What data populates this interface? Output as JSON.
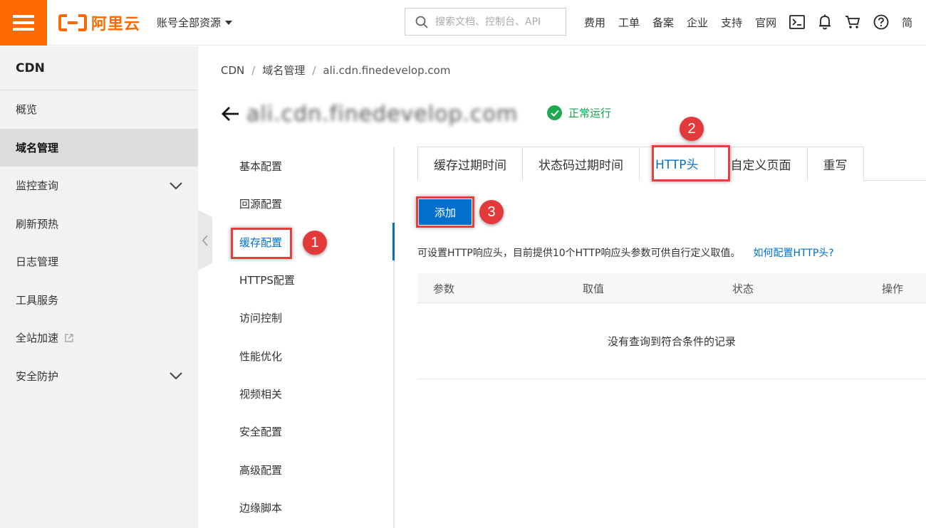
{
  "topbar": {
    "logo_text": "阿里云",
    "account_selector": "账号全部资源",
    "search_placeholder": "搜索文档、控制台、API",
    "nav_links": [
      "费用",
      "工单",
      "备案",
      "企业",
      "支持",
      "官网"
    ],
    "lang_label": "简",
    "icons": [
      "terminal-icon",
      "bell-icon",
      "cart-icon",
      "help-icon"
    ],
    "accent_color": "#ff6a00"
  },
  "sidebar": {
    "title": "CDN",
    "items": [
      {
        "label": "概览"
      },
      {
        "label": "域名管理",
        "active": true
      },
      {
        "label": "监控查询",
        "expandable": true
      },
      {
        "label": "刷新预热"
      },
      {
        "label": "日志管理"
      },
      {
        "label": "工具服务"
      },
      {
        "label": "全站加速",
        "external": true
      },
      {
        "label": "安全防护",
        "expandable": true
      }
    ]
  },
  "breadcrumb": [
    "CDN",
    "域名管理",
    "ali.cdn.finedevelop.com"
  ],
  "header": {
    "domain": "ali.cdn.finedevelop.com",
    "status": "正常运行",
    "status_color": "#1fa84f"
  },
  "subnav": {
    "items": [
      {
        "label": "基本配置"
      },
      {
        "label": "回源配置"
      },
      {
        "label": "缓存配置",
        "active": true
      },
      {
        "label": "HTTPS配置"
      },
      {
        "label": "访问控制"
      },
      {
        "label": "性能优化"
      },
      {
        "label": "视频相关"
      },
      {
        "label": "安全配置"
      },
      {
        "label": "高级配置"
      },
      {
        "label": "边缘脚本"
      }
    ]
  },
  "tabs": [
    {
      "label": "缓存过期时间"
    },
    {
      "label": "状态码过期时间"
    },
    {
      "label": "HTTP头",
      "active": true
    },
    {
      "label": "自定义页面"
    },
    {
      "label": "重写"
    }
  ],
  "main": {
    "add_button": "添加",
    "description": "可设置HTTP响应头，目前提供10个HTTP响应头参数可供自行定义取值。",
    "help_link": "如何配置HTTP头?",
    "table_columns": [
      "参数",
      "取值",
      "状态",
      "操作"
    ],
    "empty_message": "没有查询到符合条件的记录",
    "primary_color": "#0070cc"
  },
  "annotations": {
    "badges": [
      "1",
      "2",
      "3"
    ],
    "color": "#e23a3a"
  }
}
